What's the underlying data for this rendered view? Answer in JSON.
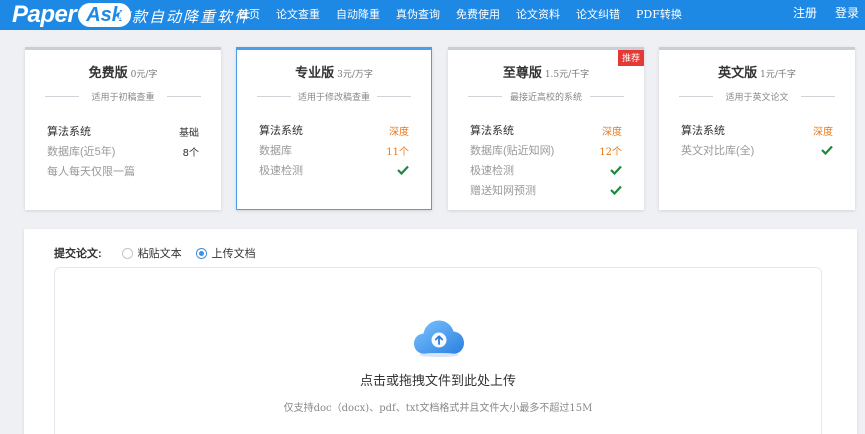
{
  "header": {
    "logo_paper": "Paper",
    "logo_ask": "Ask",
    "slogan": "首款自动降重软件",
    "nav": [
      "首页",
      "论文查重",
      "自动降重",
      "真伪查询",
      "免费使用",
      "论文资料",
      "论文纠错",
      "PDF转换"
    ],
    "register": "注册",
    "login": "登录"
  },
  "plans": [
    {
      "name": "免费版",
      "price": "0元/字",
      "subtitle": "适用于初稿查重",
      "features": [
        {
          "label": "算法系统",
          "value": "基础"
        },
        {
          "label": "数据库(近5年)",
          "value": "8个"
        },
        {
          "label": "每人每天仅限一篇",
          "value": ""
        }
      ]
    },
    {
      "name": "专业版",
      "price": "3元/万字",
      "subtitle": "适用于修改稿查重",
      "features": [
        {
          "label": "算法系统",
          "value": "深度"
        },
        {
          "label": "数据库",
          "value": "11个"
        },
        {
          "label": "极速检测",
          "value": "check-icon"
        }
      ]
    },
    {
      "name": "至尊版",
      "price": "1.5元/千字",
      "subtitle": "最接近高校的系统",
      "badge": "推荐",
      "features": [
        {
          "label": "算法系统",
          "value": "深度"
        },
        {
          "label": "数据库(贴近知网)",
          "value": "12个"
        },
        {
          "label": "极速检测",
          "value": "check-icon"
        },
        {
          "label": "赠送知网预测",
          "value": "check-icon"
        }
      ]
    },
    {
      "name": "英文版",
      "price": "1元/千字",
      "subtitle": "适用于英文论文",
      "features": [
        {
          "label": "算法系统",
          "value": "深度"
        },
        {
          "label": "英文对比库(全)",
          "value": "check-icon"
        }
      ]
    }
  ],
  "submit": {
    "label": "提交论文:",
    "options": [
      "粘贴文本",
      "上传文档"
    ],
    "selected": "上传文档",
    "upload_title": "点击或拖拽文件到此处上传",
    "upload_hint": "仅支持doc（docx)、pdf、txt文档格式并且文件大小最多不超过15M"
  },
  "colors": {
    "brand": "#1e88e5",
    "accent_orange": "#e8791e",
    "check_green": "#1a8a3a",
    "badge_red": "#e53935"
  }
}
